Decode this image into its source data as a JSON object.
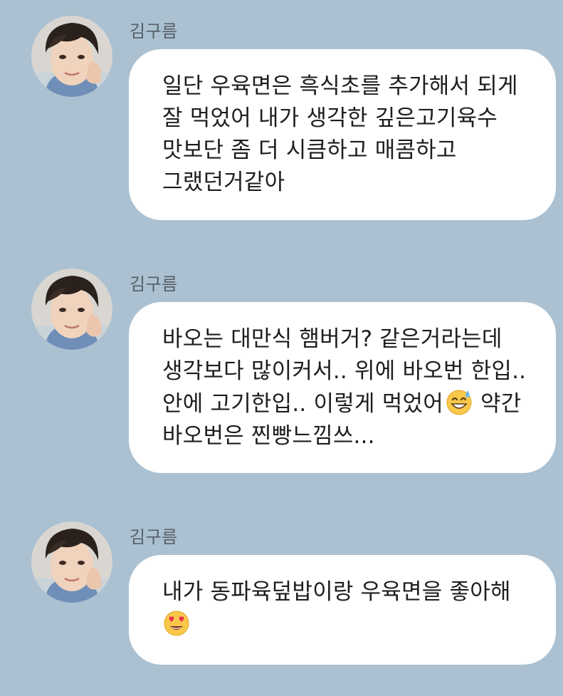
{
  "colors": {
    "background": "#abc1d1",
    "bubble": "#ffffff",
    "sender_name": "#555e66",
    "text": "#1e1e1e"
  },
  "messages": [
    {
      "sender": "김구름",
      "avatar_icon": "profile-photo-avatar",
      "lines": [
        "일단 우육면은 흑식초를 추가해서 되게",
        "잘 먹었어 내가 생각한 깊은고기육수",
        "맛보단 좀 더 시큼하고 매콤하고",
        "그랬던거같아"
      ]
    },
    {
      "sender": "김구름",
      "avatar_icon": "profile-photo-avatar",
      "lines": [
        "바오는 대만식 햄버거? 같은거라는데",
        "생각보다 많이커서.. 위에 바오번 한입..",
        "안에 고기한입.. 이렇게 먹었어",
        "바오번은 찐빵느낌쓰..."
      ],
      "line3_suffix": " 약간",
      "emoji": "grinning-face-with-sweat-icon"
    },
    {
      "sender": "김구름",
      "avatar_icon": "profile-photo-avatar",
      "lines": [
        "내가 동파육덮밥이랑 우육면을 좋아해"
      ],
      "emoji": "heart-eyes-face-icon"
    }
  ]
}
